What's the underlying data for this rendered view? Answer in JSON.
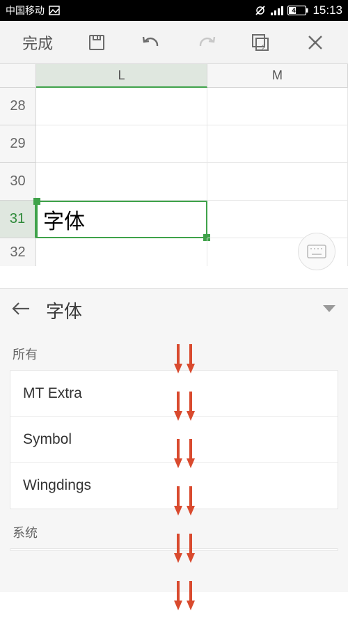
{
  "status": {
    "carrier": "中国移动",
    "battery": "43",
    "time": "15:13"
  },
  "toolbar": {
    "done": "完成",
    "copies": "2"
  },
  "sheet": {
    "cols": [
      "L",
      "M"
    ],
    "rows": [
      "28",
      "29",
      "30",
      "31",
      "32"
    ],
    "selected_row": "31",
    "selected_col": "L",
    "cell_value": "字体"
  },
  "panel": {
    "title": "字体",
    "sections": {
      "all_label": "所有",
      "system_label": "系统"
    },
    "fonts": [
      "MT Extra",
      "Symbol",
      "Wingdings"
    ]
  },
  "colors": {
    "accent": "#3fa24a",
    "arrow": "#d94a2e"
  }
}
